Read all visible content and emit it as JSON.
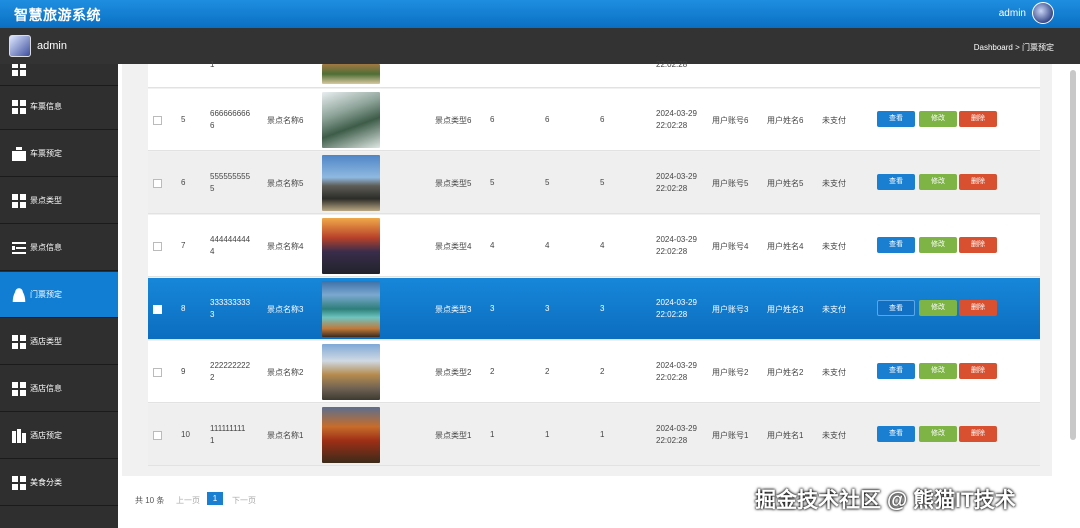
{
  "app": {
    "title": "智慧旅游系统",
    "top_user": "admin"
  },
  "header": {
    "user_name": "admin",
    "breadcrumb": "Dashboard > 门票预定"
  },
  "sidebar": {
    "items": [
      {
        "label": "车票信息",
        "icon": "grid-icon"
      },
      {
        "label": "车票预定",
        "icon": "briefcase-icon"
      },
      {
        "label": "景点类型",
        "icon": "grid-icon"
      },
      {
        "label": "景点信息",
        "icon": "list-icon"
      },
      {
        "label": "门票预定",
        "icon": "user-icon",
        "active": true
      },
      {
        "label": "酒店类型",
        "icon": "grid-icon"
      },
      {
        "label": "酒店信息",
        "icon": "grid-icon"
      },
      {
        "label": "酒店预定",
        "icon": "building-icon"
      },
      {
        "label": "美食分类",
        "icon": "grid-icon"
      }
    ]
  },
  "partial_row": {
    "no_tail": "1",
    "time_tail": "22:02:28"
  },
  "rows": [
    {
      "id": "5",
      "no_line1": "666666666",
      "no_line2": "6",
      "name": "景点名称6",
      "type": "景点类型6",
      "v1": "6",
      "v2": "6",
      "v3": "6",
      "date": "2024-03-29",
      "time": "22:02:28",
      "account": "用户账号6",
      "uname": "用户姓名6",
      "pay": "未支付"
    },
    {
      "id": "6",
      "no_line1": "555555555",
      "no_line2": "5",
      "name": "景点名称5",
      "type": "景点类型5",
      "v1": "5",
      "v2": "5",
      "v3": "5",
      "date": "2024-03-29",
      "time": "22:02:28",
      "account": "用户账号5",
      "uname": "用户姓名5",
      "pay": "未支付"
    },
    {
      "id": "7",
      "no_line1": "444444444",
      "no_line2": "4",
      "name": "景点名称4",
      "type": "景点类型4",
      "v1": "4",
      "v2": "4",
      "v3": "4",
      "date": "2024-03-29",
      "time": "22:02:28",
      "account": "用户账号4",
      "uname": "用户姓名4",
      "pay": "未支付"
    },
    {
      "id": "8",
      "no_line1": "333333333",
      "no_line2": "3",
      "name": "景点名称3",
      "type": "景点类型3",
      "v1": "3",
      "v2": "3",
      "v3": "3",
      "date": "2024-03-29",
      "time": "22:02:28",
      "account": "用户账号3",
      "uname": "用户姓名3",
      "pay": "未支付",
      "selected": true
    },
    {
      "id": "9",
      "no_line1": "222222222",
      "no_line2": "2",
      "name": "景点名称2",
      "type": "景点类型2",
      "v1": "2",
      "v2": "2",
      "v3": "2",
      "date": "2024-03-29",
      "time": "22:02:28",
      "account": "用户账号2",
      "uname": "用户姓名2",
      "pay": "未支付"
    },
    {
      "id": "10",
      "no_line1": "111111111",
      "no_line2": "1",
      "name": "景点名称1",
      "type": "景点类型1",
      "v1": "1",
      "v2": "1",
      "v3": "1",
      "date": "2024-03-29",
      "time": "22:02:28",
      "account": "用户账号1",
      "uname": "用户姓名1",
      "pay": "未支付"
    }
  ],
  "actions": {
    "view": "查看",
    "edit": "修改",
    "delete": "删除"
  },
  "pagination": {
    "total": "共 10 条",
    "prev": "上一页",
    "current": "1",
    "next": "下一页"
  },
  "watermark": "掘金技术社区 @ 熊猫IT技术"
}
